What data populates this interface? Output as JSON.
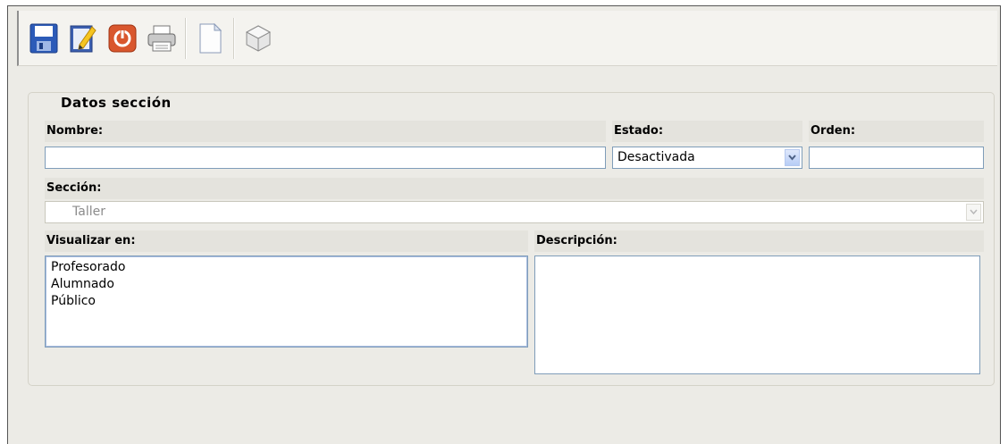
{
  "toolbar": {
    "buttons": [
      {
        "icon": "save-icon"
      },
      {
        "icon": "edit-icon"
      },
      {
        "icon": "power-icon"
      },
      {
        "icon": "print-icon"
      },
      {
        "icon": "new-document-icon"
      },
      {
        "icon": "package-icon"
      }
    ]
  },
  "form": {
    "legend": "Datos sección",
    "nombre": {
      "label": "Nombre:",
      "value": ""
    },
    "estado": {
      "label": "Estado:",
      "selected": "Desactivada"
    },
    "orden": {
      "label": "Orden:",
      "value": ""
    },
    "seccion": {
      "label": "Sección:",
      "selected": "Taller"
    },
    "visualizar": {
      "label": "Visualizar en:",
      "options": [
        "Profesorado",
        "Alumnado",
        "Público"
      ]
    },
    "descripcion": {
      "label": "Descripción:",
      "value": ""
    }
  },
  "colors": {
    "background": "#ecebe6",
    "field_border": "#7f9db9",
    "label_background": "#e4e3dd"
  }
}
